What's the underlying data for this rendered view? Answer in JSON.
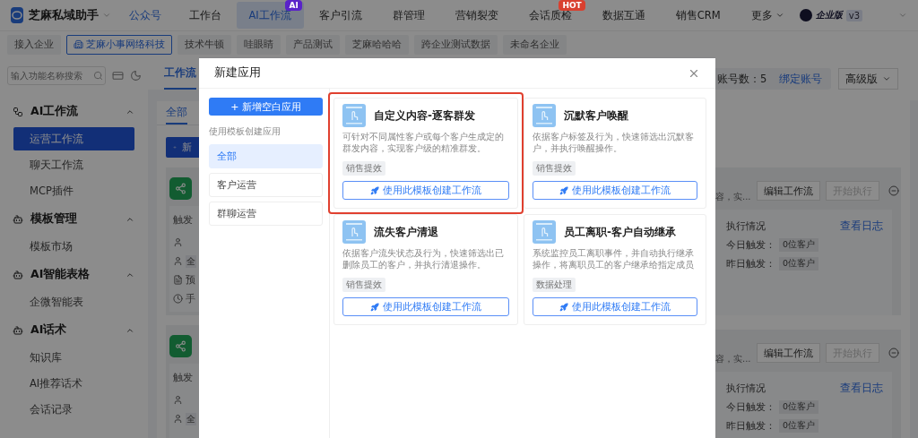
{
  "top_nav": {
    "app_name": "芝麻私域助手",
    "account_link": "公众号",
    "tabs": [
      {
        "label": "工作台",
        "selected": false
      },
      {
        "label": "AI工作流",
        "selected": true,
        "badge": {
          "text": "AI",
          "kind": "ai"
        }
      },
      {
        "label": "客户引流",
        "selected": false
      },
      {
        "label": "群管理",
        "selected": false
      },
      {
        "label": "营销裂变",
        "selected": false
      },
      {
        "label": "会话质检",
        "selected": false,
        "badge": {
          "text": "HOT",
          "kind": "hot"
        }
      },
      {
        "label": "数据互通",
        "selected": false
      },
      {
        "label": "销售CRM",
        "selected": false
      },
      {
        "label": "更多",
        "selected": false,
        "dropdown": true
      }
    ],
    "edition": "企业版",
    "version": "v3"
  },
  "company_tabs": [
    {
      "label": "接入企业",
      "selected": false
    },
    {
      "label": "芝麻小事网络科技",
      "selected": true
    },
    {
      "label": "技术牛顿",
      "selected": false
    },
    {
      "label": "哇眼睛",
      "selected": false
    },
    {
      "label": "产品测试",
      "selected": false
    },
    {
      "label": "芝麻哈哈哈",
      "selected": false
    },
    {
      "label": "跨企业测试数据",
      "selected": false
    },
    {
      "label": "未命名企业",
      "selected": false
    }
  ],
  "sidebar": {
    "search": {
      "placeholder": "输入功能名称搜索"
    },
    "groups": [
      {
        "label": "AI工作流",
        "kind": "flow",
        "expanded": true,
        "children": [
          {
            "label": "运营工作流",
            "selected": true
          },
          {
            "label": "聊天工作流",
            "selected": false
          },
          {
            "label": "MCP插件",
            "selected": false
          }
        ]
      },
      {
        "label": "模板管理",
        "kind": "ai",
        "expanded": true,
        "children": [
          {
            "label": "模板市场",
            "selected": false
          }
        ]
      },
      {
        "label": "AI智能表格",
        "kind": "ai",
        "expanded": true,
        "children": [
          {
            "label": "企微智能表",
            "selected": false
          }
        ]
      },
      {
        "label": "AI话术",
        "kind": "ai",
        "expanded": true,
        "children": [
          {
            "label": "知识库",
            "selected": false
          },
          {
            "label": "AI推荐话术",
            "selected": false
          },
          {
            "label": "会话记录",
            "selected": false
          }
        ]
      }
    ]
  },
  "page": {
    "tab": "工作流",
    "subtab": "全部",
    "new_button": "新",
    "account_count": "账号数：5",
    "bind_link": "绑定账号",
    "plan": "高级版",
    "workflows": [
      {
        "trigger_label": "触发",
        "rows": [
          {
            "kind": "user"
          },
          {
            "kind": "user",
            "tag": "全"
          },
          {
            "kind": "doc",
            "text": "预"
          },
          {
            "kind": "clock",
            "text": "手"
          }
        ],
        "desc_tail": "容，实...",
        "edit_button": "编辑工作流",
        "run_button": {
          "label": "开始执行",
          "disabled": true
        },
        "status_title": "执行情况",
        "log_link": "查看日志",
        "stats": [
          {
            "label": "今日触发：",
            "value": "0位客户"
          },
          {
            "label": "昨日触发：",
            "value": "0位客户"
          }
        ]
      },
      {
        "trigger_label": "触发",
        "rows": [
          {
            "kind": "user"
          },
          {
            "kind": "user",
            "tag": "全"
          }
        ],
        "desc_tail": "容，实...",
        "edit_button": "编辑工作流",
        "run_button": {
          "label": "开始执行",
          "disabled": true
        },
        "status_title": "执行情况",
        "log_link": "查看日志",
        "stats": [
          {
            "label": "今日触发：",
            "value": "0位客户"
          },
          {
            "label": "昨日触发：",
            "value": "0位客户"
          }
        ]
      }
    ]
  },
  "dialog": {
    "title": "新建应用",
    "blank_button": "+ 新增空白应用",
    "template_label": "使用模板创建应用",
    "categories": [
      {
        "label": "全部",
        "selected": true
      },
      {
        "label": "客户运营",
        "selected": false
      },
      {
        "label": "群聊运营",
        "selected": false
      }
    ],
    "templates": [
      {
        "title": "自定义内容-逐客群发",
        "description": "可针对不同属性客户或每个客户生成定的群发内容，实现客户级的精准群发。",
        "tag": "销售提效",
        "button": "使用此模板创建工作流",
        "highlighted": true
      },
      {
        "title": "沉默客户唤醒",
        "description": "依据客户标签及行为，快速筛选出沉默客户，并执行唤醒操作。",
        "tag": "销售提效",
        "button": "使用此模板创建工作流",
        "highlighted": false
      },
      {
        "title": "流失客户清退",
        "description": "依据客户流失状态及行为，快速筛选出已删除员工的客户，并执行清退操作。",
        "tag": "销售提效",
        "button": "使用此模板创建工作流",
        "highlighted": false
      },
      {
        "title": "员工离职-客户自动继承",
        "description": "系统监控员工离职事件，并自动执行继承操作，将离职员工的客户继承给指定成员",
        "tag": "数据处理",
        "button": "使用此模板创建工作流",
        "highlighted": false
      }
    ]
  }
}
